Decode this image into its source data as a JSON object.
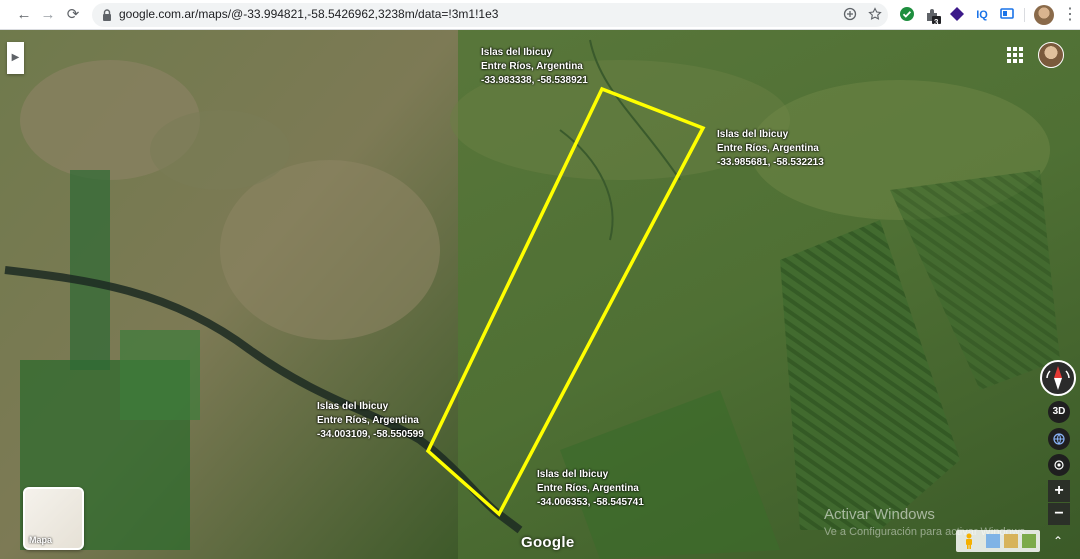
{
  "browser": {
    "url": "google.com.ar/maps/@-33.994821,-58.5426962,3238m/data=!3m1!1e3",
    "nav": {
      "back": "←",
      "forward": "→",
      "reload": "⟳"
    },
    "extensions": [
      {
        "name": "check-extension-icon",
        "color": "#1e8e3e"
      },
      {
        "name": "puzzle-extension-icon",
        "color": "#5f6368",
        "badge": "3"
      },
      {
        "name": "diamond-extension-icon",
        "color": "#3c1a8a"
      },
      {
        "label": "IQ",
        "name": "iq-extension-icon",
        "color": "#1a73e8"
      },
      {
        "name": "monitor-extension-icon",
        "color": "#1a73e8"
      }
    ]
  },
  "map": {
    "annotations": [
      {
        "place": "Islas del Ibicuy",
        "region": "Entre Ríos, Argentina",
        "coords": "-33.983338, -58.538921"
      },
      {
        "place": "Islas del Ibicuy",
        "region": "Entre Ríos, Argentina",
        "coords": "-33.985681, -58.532213"
      },
      {
        "place": "Islas del Ibicuy",
        "region": "Entre Ríos, Argentina",
        "coords": "-34.003109, -58.550599"
      },
      {
        "place": "Islas del Ibicuy",
        "region": "Entre Ríos, Argentina",
        "coords": "-34.006353, -58.545741"
      }
    ],
    "polygon_color": "#ffff00",
    "layer_label": "Mapa",
    "logo": "Google",
    "controls": {
      "tilt": "3D",
      "zoom_in": "+",
      "zoom_out": "−",
      "collapse": "⌃"
    }
  },
  "watermark": {
    "title": "Activar Windows",
    "subtitle": "Ve a Configuración para activar Windows."
  }
}
